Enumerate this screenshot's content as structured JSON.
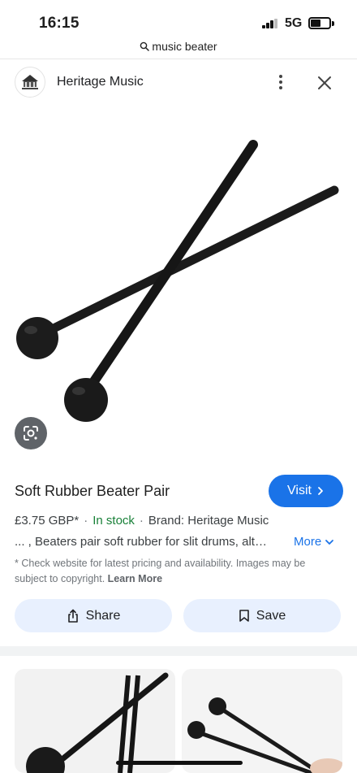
{
  "status_bar": {
    "time": "16:15",
    "network": "5G",
    "icons": [
      "signal-icon",
      "battery-icon"
    ]
  },
  "url_bar": {
    "query": "music beater",
    "icon": "search-icon"
  },
  "source": {
    "site_name": "Heritage Music",
    "logo_icon": "site-logo-icon",
    "more_icon": "more-vert-icon",
    "close_icon": "close-icon"
  },
  "product": {
    "image_icon": "beater-pair-image",
    "lens_icon": "lens-icon",
    "title": "Soft Rubber Beater Pair",
    "visit_label": "Visit",
    "price": "£3.75 GBP*",
    "stock": "In stock",
    "brand": "Brand: Heritage Music",
    "description": "... , Beaters pair soft rubber for slit drums, alt…",
    "more_label": "More",
    "disclaimer": "* Check website for latest pricing and availability. Images may be subject to copyright.",
    "learn_more": "Learn More"
  },
  "actions": {
    "share_label": "Share",
    "save_label": "Save"
  },
  "colors": {
    "accent": "#1a73e8",
    "in_stock": "#188038",
    "pill_bg": "#e8f0fe"
  }
}
